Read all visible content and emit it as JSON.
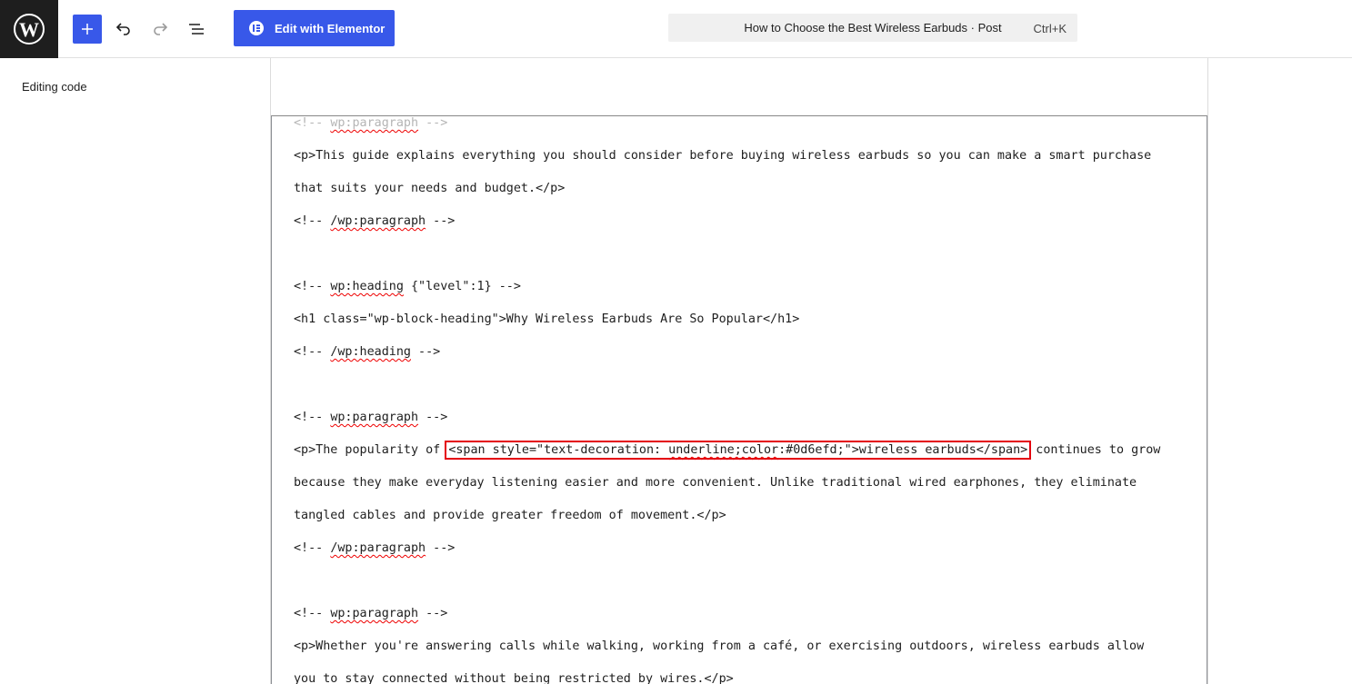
{
  "header": {
    "elementor_label": "Edit with Elementor",
    "document_title": "How to Choose the Best Wireless Earbuds · Post",
    "shortcut": "Ctrl+K"
  },
  "sidebar": {
    "label": "Editing code"
  },
  "icons": {
    "logo": "wordpress-icon",
    "add": "plus-icon",
    "undo": "undo-icon",
    "redo": "redo-icon",
    "outline": "list-view-icon",
    "elementor": "elementor-icon"
  },
  "colors": {
    "accent": "#3858e9",
    "highlight": "#e4000f",
    "dark": "#1e1e1e"
  },
  "code": {
    "l0a": "<!-- ",
    "l0b": "wp:paragraph",
    "l0c": " -->",
    "l1": "<p>This guide explains everything you should consider before buying wireless earbuds so you can make a smart purchase",
    "l2": "that suits your needs and budget.</p>",
    "l3a": "<!-- ",
    "l3b": "/wp:paragraph",
    "l3c": " -->",
    "l5a": "<!-- ",
    "l5b": "wp:heading",
    "l5c": " {\"level\":1} -->",
    "l6": "<h1 class=\"wp-block-heading\">Why Wireless Earbuds Are So Popular</h1>",
    "l7a": "<!-- ",
    "l7b": "/wp:heading",
    "l7c": " -->",
    "l9a": "<!-- ",
    "l9b": "wp:paragraph",
    "l9c": " -->",
    "l10a": "<p>The popularity of ",
    "l10b": "<span style=\"text-decoration: ",
    "l10c": "underline;color",
    "l10d": ":#0d6efd;\">wireless earbuds</span>",
    "l10e": " continues to grow",
    "l11": "because they make everyday listening easier and more convenient. Unlike traditional wired earphones, they eliminate",
    "l12": "tangled cables and provide greater freedom of movement.</p>",
    "l13a": "<!-- ",
    "l13b": "/wp:paragraph",
    "l13c": " -->",
    "l15a": "<!-- ",
    "l15b": "wp:paragraph",
    "l15c": " -->",
    "l16": "<p>Whether you're answering calls while walking, working from a café, or exercising outdoors, wireless earbuds allow",
    "l17": "you to stay connected without being restricted by wires.</p>"
  }
}
